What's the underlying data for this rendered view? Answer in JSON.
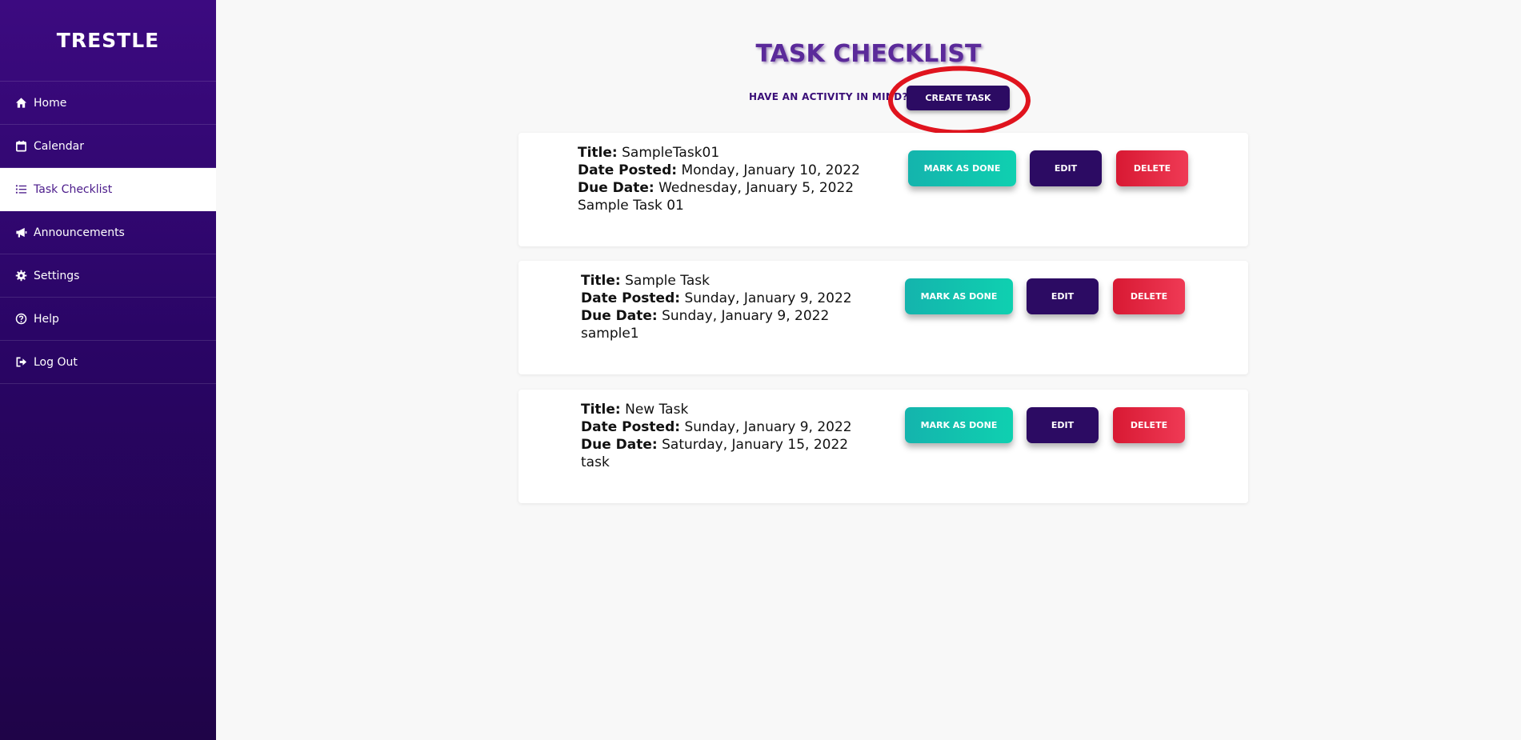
{
  "sidebar": {
    "brand": "TRESTLE",
    "items": [
      {
        "label": "Home",
        "icon": "home-icon"
      },
      {
        "label": "Calendar",
        "icon": "calendar-icon"
      },
      {
        "label": "Task Checklist",
        "icon": "list-icon",
        "active": true
      },
      {
        "label": "Announcements",
        "icon": "megaphone-icon"
      },
      {
        "label": "Settings",
        "icon": "gear-icon"
      },
      {
        "label": "Help",
        "icon": "help-icon"
      },
      {
        "label": "Log Out",
        "icon": "logout-icon"
      }
    ]
  },
  "main": {
    "title": "TASK CHECKLIST",
    "prompt": "HAVE AN ACTIVITY IN MIND?",
    "create_label": "CREATE TASK",
    "labels": {
      "title": "Title:",
      "date_posted": "Date Posted:",
      "due_date": "Due Date:"
    },
    "buttons": {
      "done": "MARK AS DONE",
      "edit": "EDIT",
      "delete": "DELETE"
    },
    "tasks": [
      {
        "title": "SampleTask01",
        "date_posted": "Monday, January 10, 2022",
        "due_date": "Wednesday, January 5, 2022",
        "description": "Sample Task 01"
      },
      {
        "title": "Sample Task",
        "date_posted": "Sunday, January 9, 2022",
        "due_date": "Sunday, January 9, 2022",
        "description": "sample1"
      },
      {
        "title": "New Task",
        "date_posted": "Sunday, January 9, 2022",
        "due_date": "Saturday, January 15, 2022",
        "description": "task"
      }
    ]
  },
  "colors": {
    "sidebar_top": "#3c0a80",
    "sidebar_bottom": "#1f0448",
    "primary": "#2c0b63",
    "teal": "#14b4ad",
    "red": "#d81933",
    "annotation": "#e0141e"
  }
}
